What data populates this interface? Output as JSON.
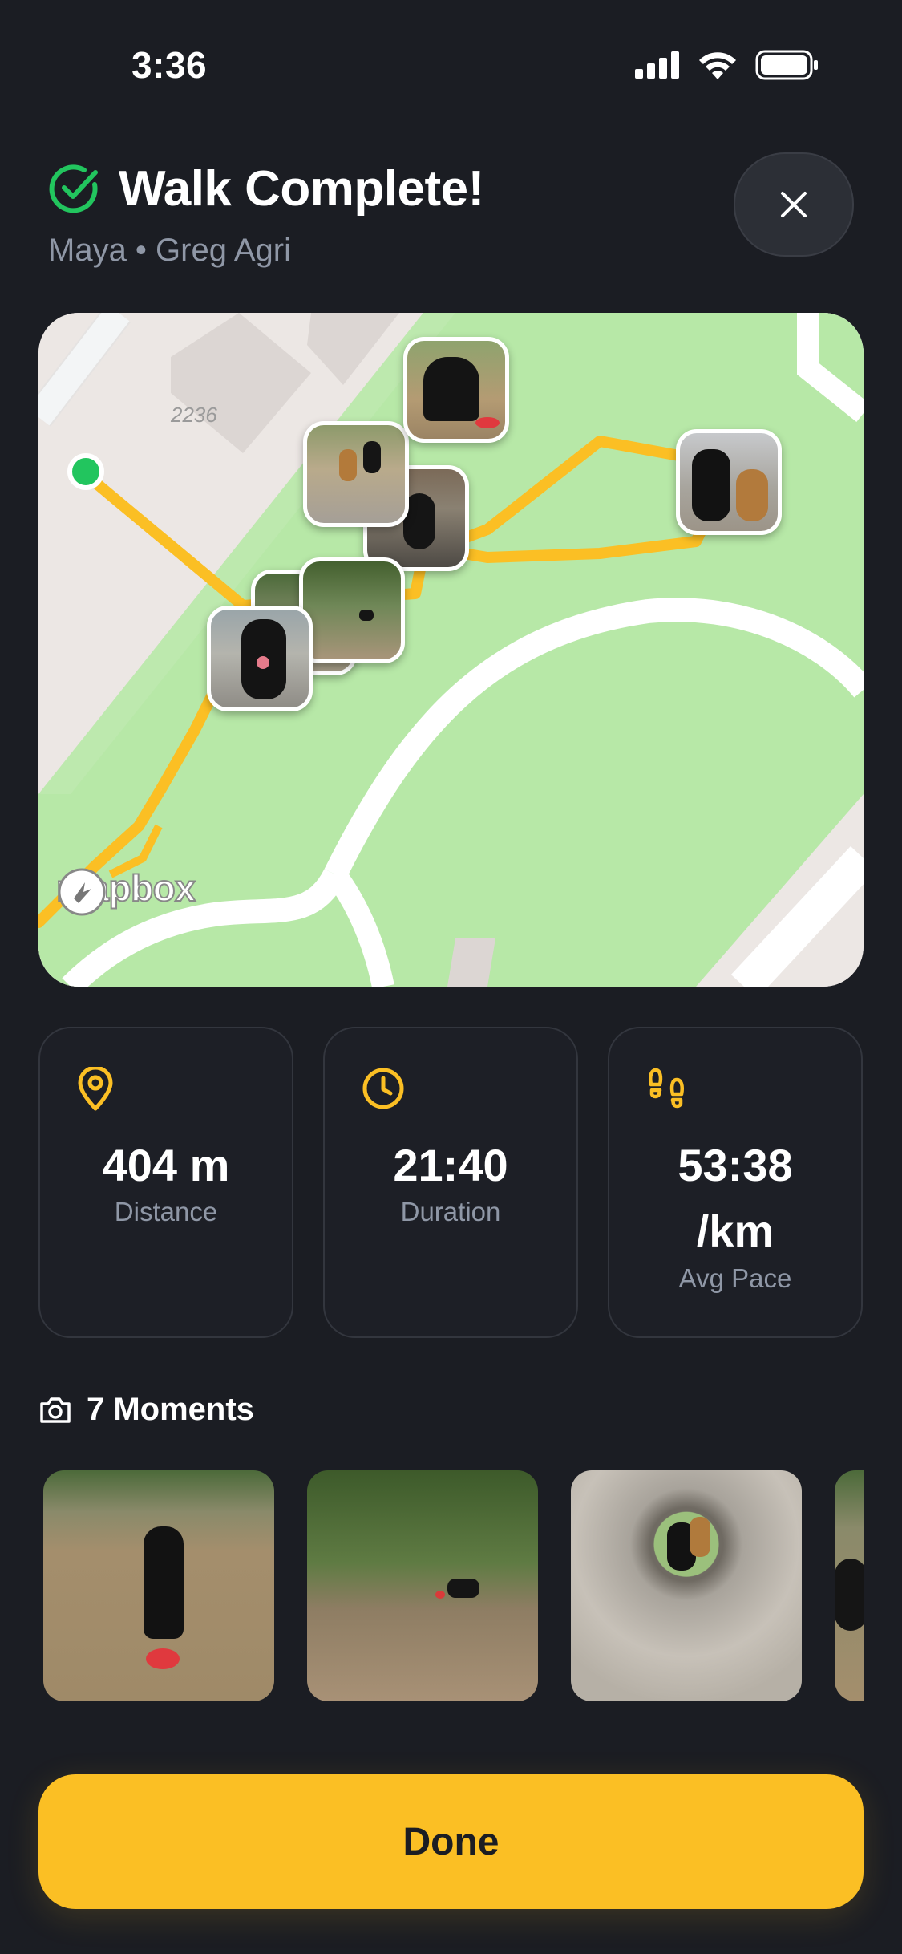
{
  "status_bar": {
    "time": "3:36",
    "icons": [
      "cellular-signal-icon",
      "wifi-icon",
      "battery-icon"
    ]
  },
  "header": {
    "title": "Walk Complete!",
    "subtitle": "Maya • Greg Agri",
    "check_icon": "check-circle-icon",
    "close_icon": "close-icon"
  },
  "map": {
    "street_number": "2236",
    "attribution": "mapbox",
    "route_color": "#fbbf24",
    "park_color": "#b7e8a7",
    "photo_pin_count": 7
  },
  "stats": [
    {
      "icon": "map-pin-icon",
      "value": "404 m",
      "label": "Distance"
    },
    {
      "icon": "clock-icon",
      "value": "21:40",
      "label": "Duration"
    },
    {
      "icon": "footprints-icon",
      "value_line1": "53:38",
      "value_line2": "/km",
      "label": "Avg Pace"
    }
  ],
  "moments": {
    "icon": "camera-icon",
    "title": "7 Moments"
  },
  "done_button": {
    "label": "Done"
  },
  "colors": {
    "accent": "#fbbf24",
    "background": "#1b1d23",
    "success": "#22c55e",
    "muted": "#8f97a6"
  }
}
